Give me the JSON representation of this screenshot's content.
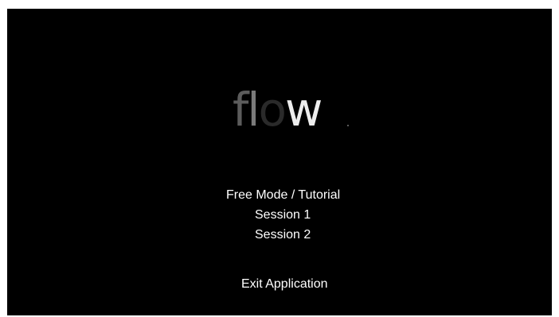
{
  "app": {
    "logo": {
      "letters": [
        "f",
        "l",
        "o",
        "w"
      ]
    }
  },
  "menu": {
    "items": [
      {
        "label": "Free Mode / Tutorial"
      },
      {
        "label": "Session 1"
      },
      {
        "label": "Session 2"
      }
    ],
    "exit_label": "Exit Application"
  },
  "colors": {
    "background": "#000000",
    "text": "#ffffff"
  }
}
